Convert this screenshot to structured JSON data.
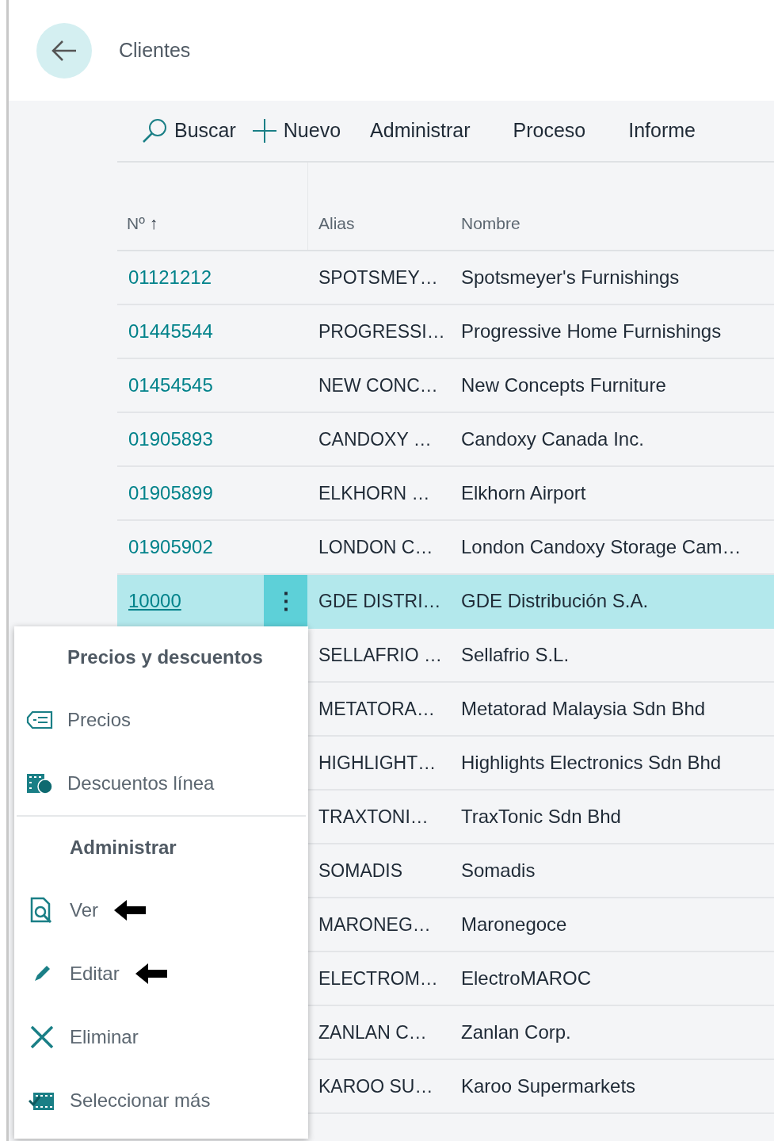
{
  "page": {
    "title": "Clientes"
  },
  "toolbar": [
    {
      "label": "Buscar",
      "kind": "search"
    },
    {
      "label": "Nuevo",
      "kind": "new"
    },
    {
      "label": "Administrar",
      "kind": "text"
    },
    {
      "label": "Proceso",
      "kind": "text"
    },
    {
      "label": "Informe",
      "kind": "text"
    }
  ],
  "table": {
    "columns": [
      "Nº",
      "Alias",
      "Nombre"
    ],
    "sort_icon": "↑",
    "rows": [
      {
        "no": "01121212",
        "alias": "SPOTSMEY…",
        "name": "Spotsmeyer's Furnishings",
        "selected": false
      },
      {
        "no": "01445544",
        "alias": "PROGRESSI…",
        "name": "Progressive Home Furnishings",
        "selected": false
      },
      {
        "no": "01454545",
        "alias": "NEW CONC…",
        "name": "New Concepts Furniture",
        "selected": false
      },
      {
        "no": "01905893",
        "alias": "CANDOXY …",
        "name": "Candoxy Canada Inc.",
        "selected": false
      },
      {
        "no": "01905899",
        "alias": "ELKHORN …",
        "name": "Elkhorn Airport",
        "selected": false
      },
      {
        "no": "01905902",
        "alias": "LONDON C…",
        "name": "London Candoxy Storage Cam…",
        "selected": false
      },
      {
        "no": "10000",
        "alias": "GDE DISTRI…",
        "name": "GDE Distribución S.A.",
        "selected": true,
        "more": "⋮"
      },
      {
        "alias": "SELLAFRIO …",
        "name": "Sellafrio S.L.",
        "selected": false
      },
      {
        "alias": "METATORA…",
        "name": "Metatorad Malaysia Sdn Bhd",
        "selected": false
      },
      {
        "alias": "HIGHLIGHT…",
        "name": "Highlights Electronics Sdn Bhd",
        "selected": false
      },
      {
        "alias": "TRAXTONI…",
        "name": "TraxTonic Sdn Bhd",
        "selected": false
      },
      {
        "alias": "SOMADIS",
        "name": "Somadis",
        "selected": false
      },
      {
        "alias": "MARONEG…",
        "name": "Maronegoce",
        "selected": false
      },
      {
        "alias": "ELECTROM…",
        "name": "ElectroMAROC",
        "selected": false
      },
      {
        "alias": "ZANLAN C…",
        "name": "Zanlan Corp.",
        "selected": false
      },
      {
        "alias": "KAROO SU…",
        "name": "Karoo Supermarkets",
        "selected": false
      }
    ]
  },
  "context_menu": {
    "groups": [
      {
        "title": "Precios y descuentos",
        "items": [
          {
            "label": "Precios",
            "kind": "tag",
            "pointed": false
          },
          {
            "label": "Descuentos línea",
            "kind": "grid",
            "pointed": false
          }
        ]
      },
      {
        "title": "Administrar",
        "items": [
          {
            "label": "Ver",
            "kind": "view",
            "pointed": true
          },
          {
            "label": "Editar",
            "kind": "pencil",
            "pointed": true
          },
          {
            "label": "Eliminar",
            "kind": "delete",
            "pointed": false
          },
          {
            "label": "Seleccionar más",
            "kind": "select",
            "pointed": false
          }
        ]
      }
    ]
  }
}
